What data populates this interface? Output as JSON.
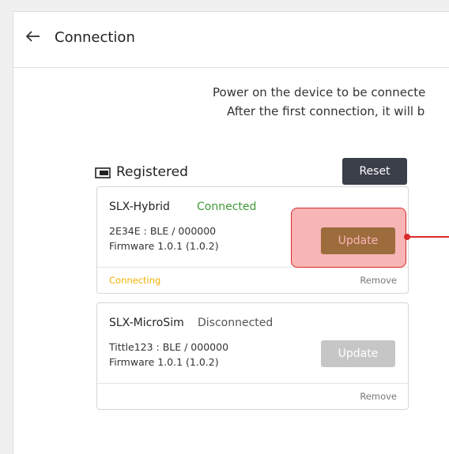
{
  "header": {
    "title": "Connection"
  },
  "instructions": {
    "line1": "Power on the device to be connecte",
    "line2": "After the first connection, it will b"
  },
  "registered": {
    "label": "Registered",
    "reset_label": "Reset"
  },
  "devices": [
    {
      "name": "SLX-Hybrid",
      "status": "Connected",
      "id_line": "2E34E : BLE / 000000",
      "firmware": "Firmware 1.0.1 (1.0.2)",
      "update_label": "Update",
      "footer_status": "Connecting",
      "remove_label": "Remove"
    },
    {
      "name": "SLX-MicroSim",
      "status": "Disconnected",
      "id_line": "Tittle123 : BLE / 000000",
      "firmware": "Firmware 1.0.1 (1.0.2)",
      "update_label": "Update",
      "footer_status": "",
      "remove_label": "Remove"
    }
  ],
  "colors": {
    "connected": "#3f9a37",
    "update_active": "#5a7a26",
    "update_disabled": "#c6c6c6",
    "connecting": "#f2b100",
    "reset_bg": "#3a3f4a",
    "highlight": "#d92b2b"
  },
  "icons": {
    "back": "arrow-left-icon",
    "registered": "device-card-icon"
  }
}
